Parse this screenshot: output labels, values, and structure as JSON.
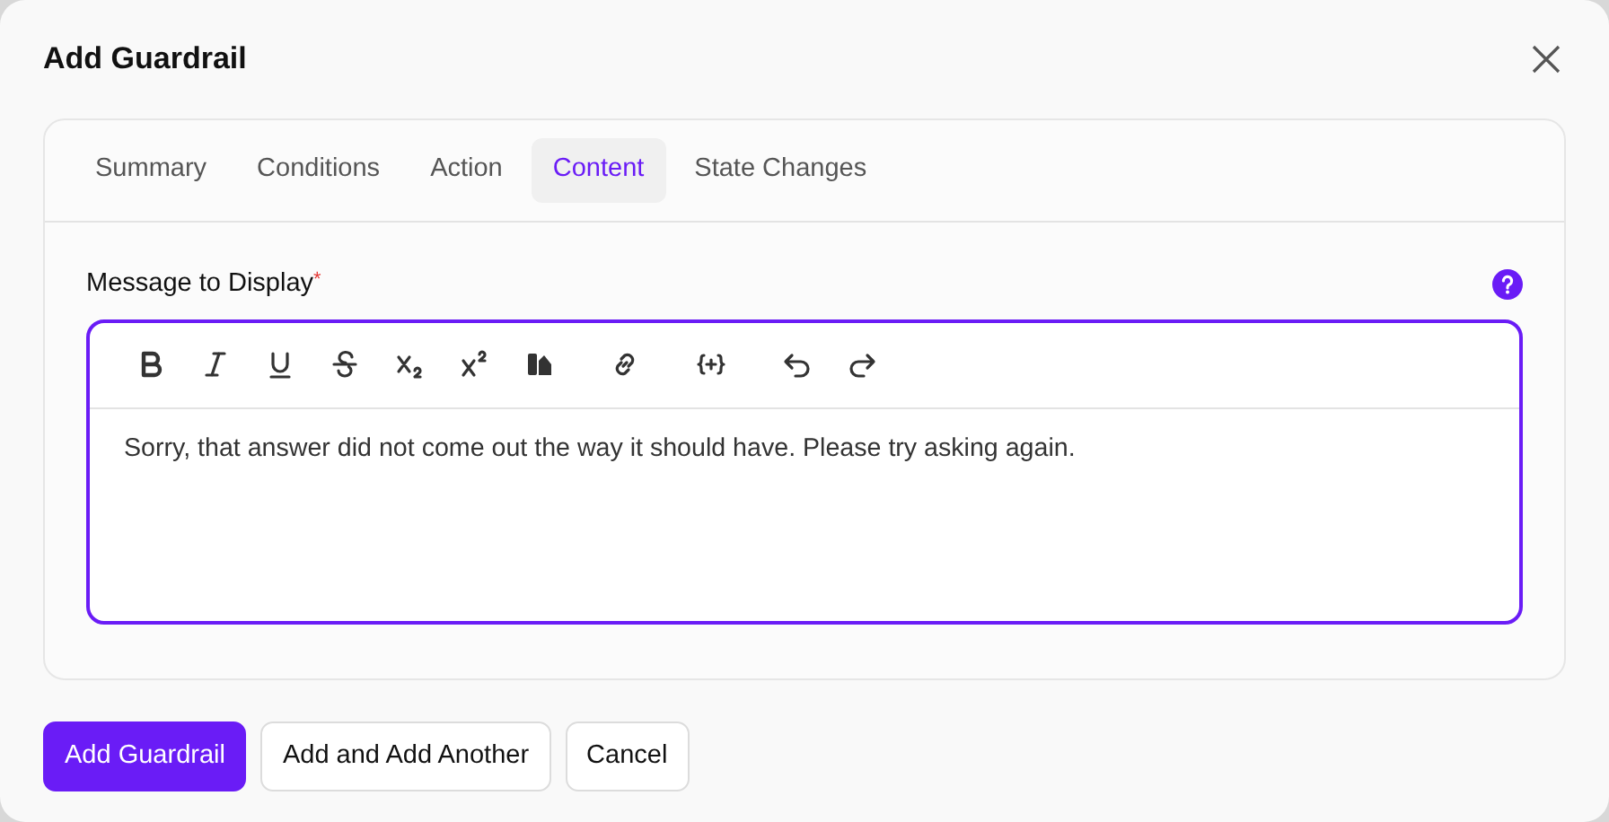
{
  "dialog": {
    "title": "Add Guardrail"
  },
  "tabs": [
    {
      "label": "Summary",
      "selected": false
    },
    {
      "label": "Conditions",
      "selected": false
    },
    {
      "label": "Action",
      "selected": false
    },
    {
      "label": "Content",
      "selected": true
    },
    {
      "label": "State Changes",
      "selected": false
    }
  ],
  "field": {
    "label": "Message to Display",
    "required_mark": "*",
    "value": "Sorry, that answer did not come out the way it should have. Please try asking again.",
    "focused": true
  },
  "buttons": [
    {
      "label": "Add Guardrail",
      "kind": "primary"
    },
    {
      "label": "Add and Add Another",
      "kind": "secondary"
    },
    {
      "label": "Cancel",
      "kind": "secondary"
    }
  ]
}
